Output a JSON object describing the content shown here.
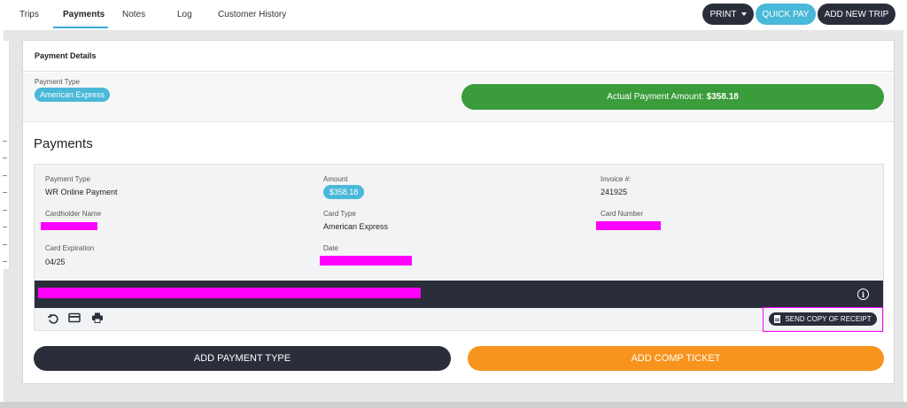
{
  "nav": {
    "tabs": [
      "Trips",
      "Payments",
      "Notes",
      "Log",
      "Customer History"
    ],
    "active_tab": "Payments",
    "print_label": "PRINT",
    "quick_pay_label": "QUICK PAY",
    "add_trip_label": "ADD NEW TRIP"
  },
  "payment_details": {
    "title": "Payment Details",
    "type_label": "Payment Type",
    "type_value": "American Express",
    "actual_amount_label": "Actual Payment Amount:",
    "actual_amount_value": "$358.18"
  },
  "payments": {
    "title": "Payments",
    "entry": {
      "payment_type_label": "Payment Type",
      "payment_type_value": "WR Online Payment",
      "amount_label": "Amount",
      "amount_value": "$358.18",
      "invoice_label": "Invoice #:",
      "invoice_value": "241925",
      "cardholder_label": "Cardholder Name",
      "card_type_label": "Card Type",
      "card_type_value": "American Express",
      "card_number_label": "Card Number",
      "expiration_label": "Card Expiration",
      "expiration_value": "04/25",
      "date_label": "Date"
    },
    "send_receipt_label": "SEND COPY OF RECEIPT"
  },
  "actions": {
    "add_payment_type": "ADD PAYMENT TYPE",
    "add_comp_ticket": "ADD COMP TICKET"
  },
  "colors": {
    "dark": "#2a2e3b",
    "accent_blue": "#4ab8d8",
    "success_green": "#3a9c3a",
    "orange": "#f7941d",
    "redaction": "#ff00ff"
  },
  "icons": [
    "undo-icon",
    "credit-card-icon",
    "printer-icon",
    "info-icon",
    "document-icon",
    "caret-down-icon"
  ]
}
